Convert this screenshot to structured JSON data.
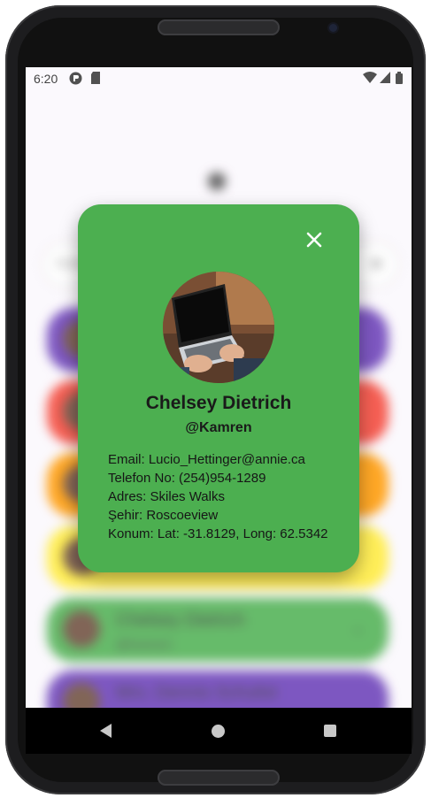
{
  "status_bar": {
    "time": "6:20",
    "icons": [
      "app-notification-icon",
      "sd-card-icon",
      "wifi-icon",
      "signal-icon",
      "battery-icon"
    ]
  },
  "background_list": {
    "search_placeholder": "Kullanıcı ara",
    "cards": [
      {
        "color": "#673ab7",
        "name": "",
        "username": ""
      },
      {
        "color": "#f44336",
        "name": "",
        "username": ""
      },
      {
        "color": "#ff9800",
        "name": "",
        "username": ""
      },
      {
        "color": "#ffeb3b",
        "name": "",
        "username": ""
      },
      {
        "color": "#4caf50",
        "name": "Chelsey Dietrich",
        "username": "@Kamren"
      },
      {
        "color": "#673ab7",
        "name": "Mrs. Dennis Schulist",
        "username": ""
      }
    ]
  },
  "dialog": {
    "background": "#4caf50",
    "close_icon": "close-icon",
    "name": "Chelsey Dietrich",
    "username": "@Kamren",
    "email": "Email: Lucio_Hettinger@annie.ca",
    "phone": "Telefon No: (254)954-1289",
    "address": "Adres: Skiles Walks",
    "city": "Şehir: Roscoeview",
    "location": "Konum: Lat: -31.8129, Long: 62.5342"
  },
  "nav": {
    "back_icon": "back-icon",
    "home_icon": "home-icon",
    "recents_icon": "recents-icon"
  }
}
